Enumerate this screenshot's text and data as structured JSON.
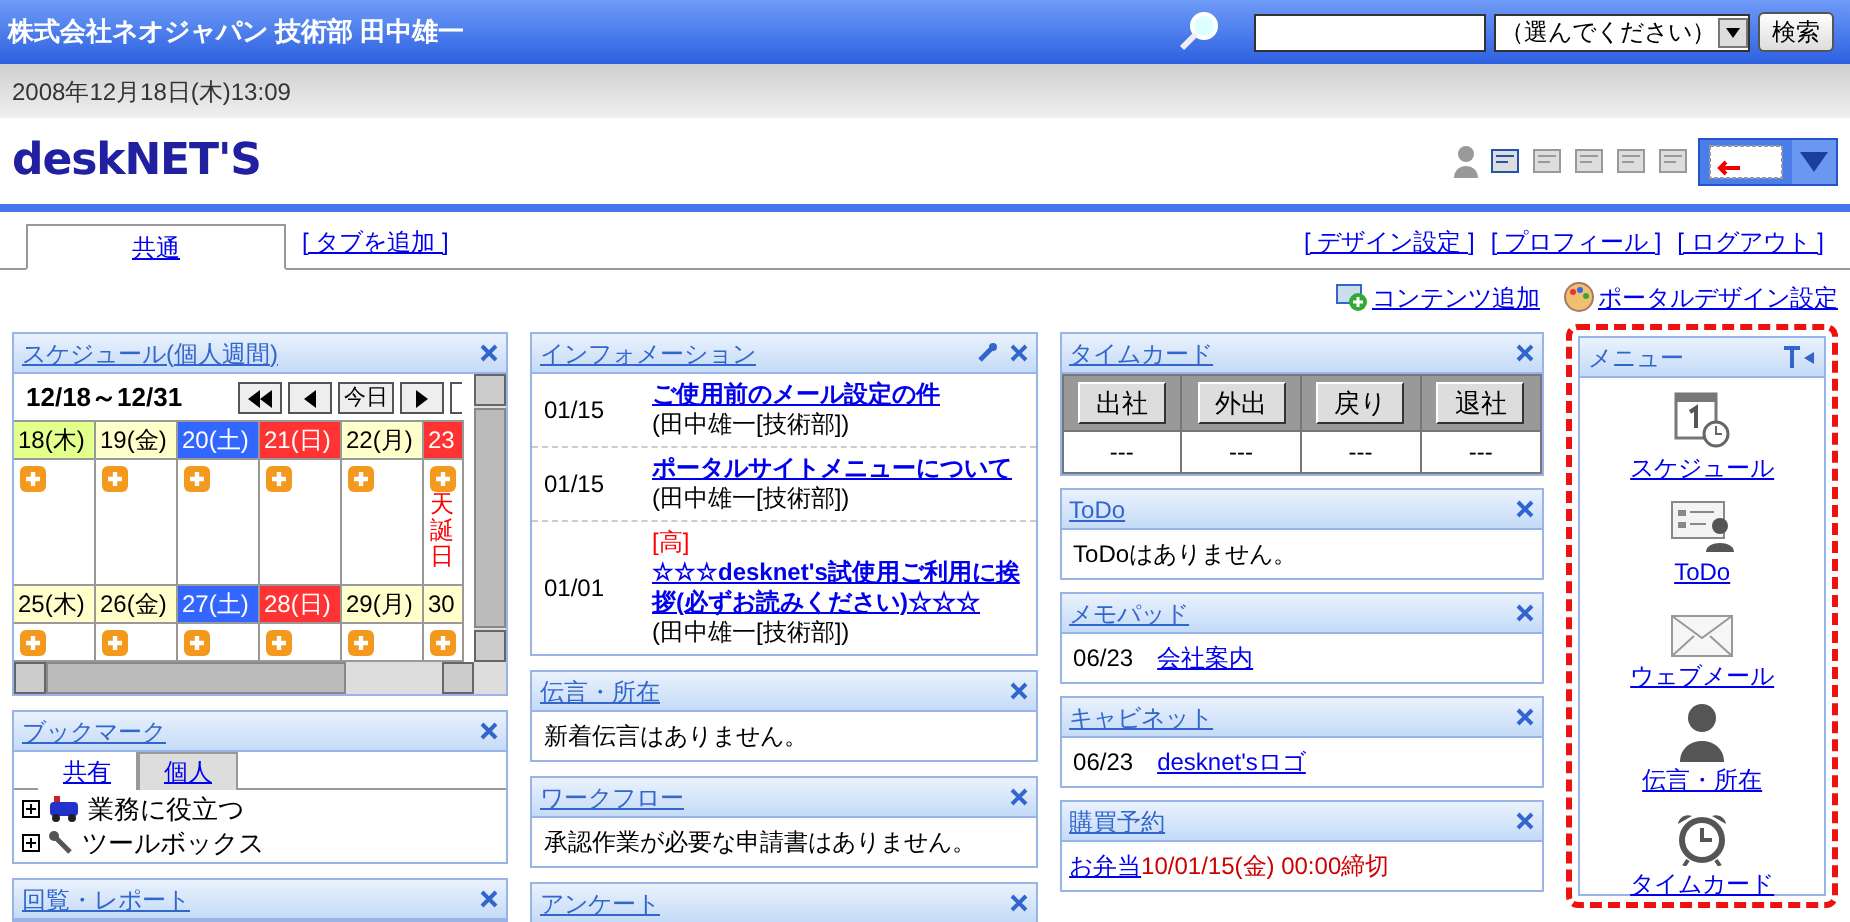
{
  "header": {
    "title": "株式会社ネオジャパン 技術部 田中雄一",
    "select": "（選んでください）",
    "search_button": "検索"
  },
  "datetime": "2008年12月18日(木)13:09",
  "logo": "deskNET'S",
  "tabs": [
    {
      "label": "共通",
      "selected": true
    }
  ],
  "add_tab": "[ タブを追加 ]",
  "top_links": [
    "[ デザイン設定 ]",
    "[ プロフィール ]",
    "[ ログアウト ]"
  ],
  "actions": [
    {
      "label": "コンテンツ追加",
      "kind": "add"
    },
    {
      "label": "ポータルデザイン設定",
      "kind": "palette"
    }
  ],
  "schedule": {
    "title": "スケジュール(個人週間)",
    "range": "12/18～12/31",
    "today_button": "今日",
    "weeks": [
      {
        "days": [
          {
            "label": "18(木)",
            "kind": "today"
          },
          {
            "label": "19(金)",
            "kind": "weekday"
          },
          {
            "label": "20(土)",
            "kind": "saturday"
          },
          {
            "label": "21(日)",
            "kind": "holiday"
          },
          {
            "label": "22(月)",
            "kind": "weekday"
          },
          {
            "label": "23",
            "kind": "holiday",
            "event": "天誕日"
          }
        ]
      },
      {
        "days": [
          {
            "label": "25(木)",
            "kind": "weekday"
          },
          {
            "label": "26(金)",
            "kind": "weekday"
          },
          {
            "label": "27(土)",
            "kind": "saturday"
          },
          {
            "label": "28(日)",
            "kind": "holiday"
          },
          {
            "label": "29(月)",
            "kind": "weekday"
          },
          {
            "label": "30",
            "kind": "weekday"
          }
        ]
      }
    ]
  },
  "bookmark": {
    "title": "ブックマーク",
    "tabs": [
      {
        "label": "共有",
        "selected": true
      },
      {
        "label": "個人",
        "selected": false
      }
    ],
    "items": [
      {
        "label": "業務に役立つ",
        "kind": "vehicle",
        "expanded": false
      },
      {
        "label": "ツールボックス",
        "kind": "tool",
        "expanded": false
      }
    ]
  },
  "circular": {
    "title": "回覧・レポート"
  },
  "information": {
    "title": "インフォメーション",
    "items": [
      {
        "date": "01/15",
        "title": "ご使用前のメール設定の件",
        "author": "(田中雄一[技術部])"
      },
      {
        "date": "01/15",
        "title": "ポータルサイトメニューについて",
        "author": "(田中雄一[技術部])"
      },
      {
        "date": "01/01",
        "badge": "[高]",
        "title": "☆☆☆desknet's試使用ご利用に挨拶(必ずお読みください)☆☆☆",
        "author": "(田中雄一[技術部])"
      }
    ]
  },
  "messages": {
    "title": "伝言・所在",
    "text": "新着伝言はありません。"
  },
  "workflow": {
    "title": "ワークフロー",
    "text": "承認作業が必要な申請書はありません。"
  },
  "survey": {
    "title": "アンケート"
  },
  "timecard": {
    "title": "タイムカード",
    "columns": [
      {
        "button": "出社",
        "value": "---"
      },
      {
        "button": "外出",
        "value": "---"
      },
      {
        "button": "戻り",
        "value": "---"
      },
      {
        "button": "退社",
        "value": "---"
      }
    ]
  },
  "todo": {
    "title": "ToDo",
    "text": "ToDoはありません。"
  },
  "memopad": {
    "title": "メモパッド",
    "items": [
      {
        "date": "06/23",
        "link": "会社案内"
      }
    ]
  },
  "cabinet": {
    "title": "キャビネット",
    "items": [
      {
        "date": "06/23",
        "link": "desknet'sロゴ"
      }
    ]
  },
  "purchase": {
    "title": "購買予約",
    "items": [
      {
        "link": "お弁当",
        "deadline": "10/01/15(金) 00:00締切"
      }
    ]
  },
  "menu": {
    "title": "メニュー",
    "items": [
      {
        "label": "スケジュール",
        "kind": "schedule"
      },
      {
        "label": "ToDo",
        "kind": "todo"
      },
      {
        "label": "ウェブメール",
        "kind": "mail"
      },
      {
        "label": "伝言・所在",
        "kind": "person"
      },
      {
        "label": "タイムカード",
        "kind": "clock"
      }
    ]
  }
}
